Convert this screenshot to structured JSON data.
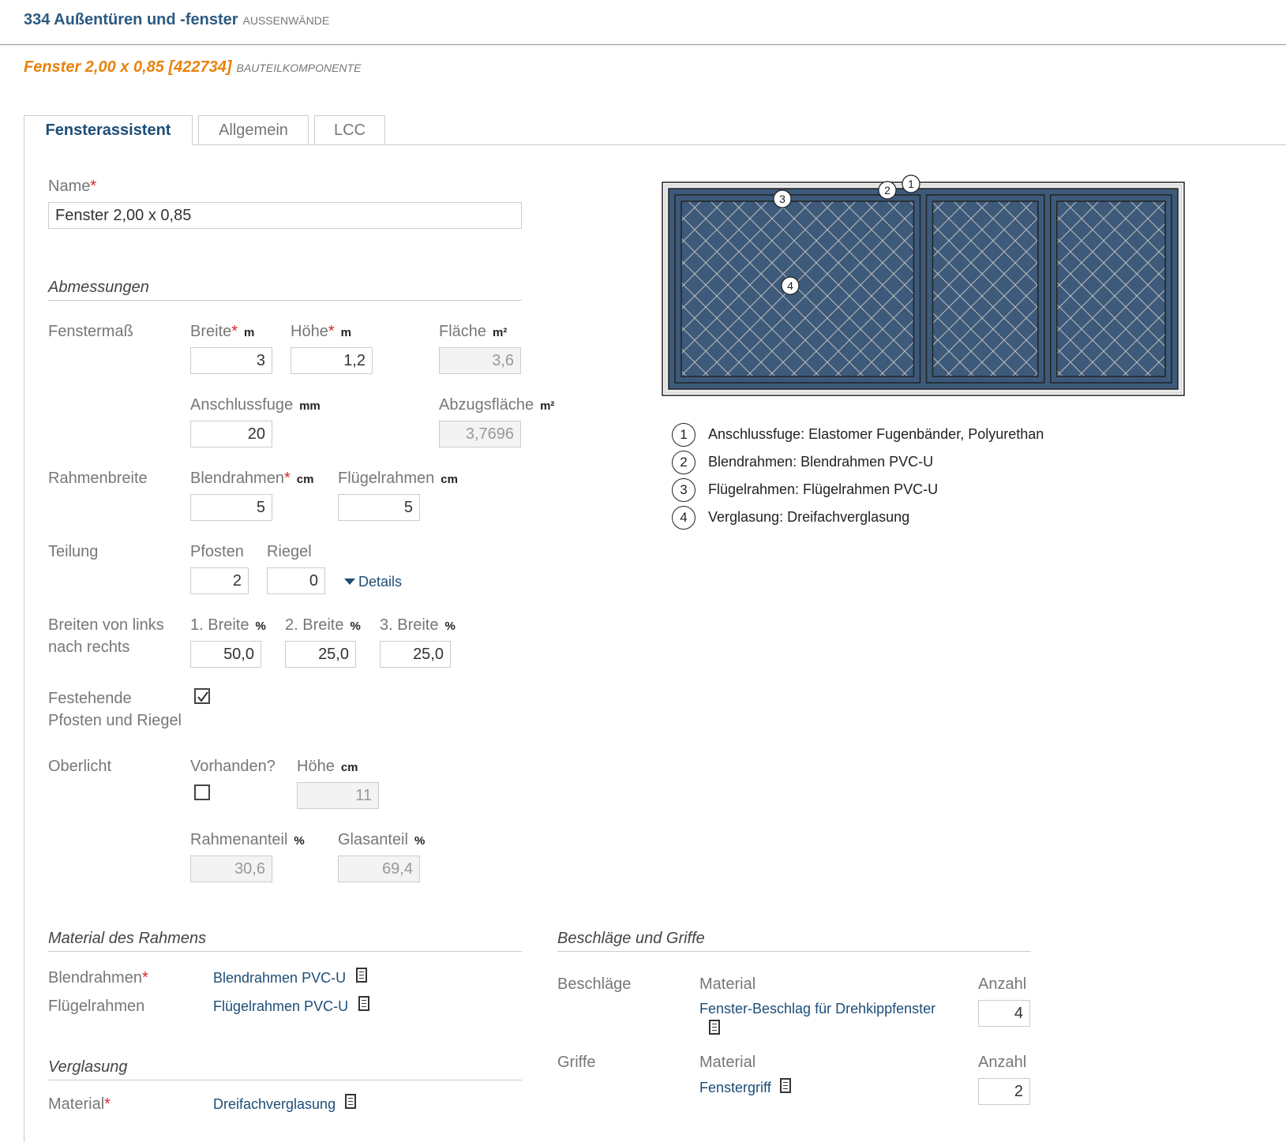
{
  "header": {
    "title": "334 Außentüren und -fenster",
    "subtitle": "AUSSENWÄNDE"
  },
  "component": {
    "title": "Fenster 2,00 x 0,85 [422734]",
    "subtitle": "BAUTEILKOMPONENTE"
  },
  "tabs": [
    {
      "label": "Fensterassistent",
      "active": true
    },
    {
      "label": "Allgemein"
    },
    {
      "label": "LCC"
    }
  ],
  "name": {
    "label": "Name",
    "value": "Fenster 2,00 x 0,85"
  },
  "abmessungen": {
    "title": "Abmessungen",
    "fenstermass": {
      "label": "Fenstermaß",
      "breite": {
        "label": "Breite",
        "unit": "m",
        "value": "3"
      },
      "hoehe": {
        "label": "Höhe",
        "unit": "m",
        "value": "1,2"
      },
      "flaeche": {
        "label": "Fläche",
        "unit": "m²",
        "value": "3,6"
      },
      "anschlussfuge": {
        "label": "Anschlussfuge",
        "unit": "mm",
        "value": "20"
      },
      "abzugsflaeche": {
        "label": "Abzugsfläche",
        "unit": "m²",
        "value": "3,7696"
      }
    },
    "rahmenbreite": {
      "label": "Rahmenbreite",
      "blendrahmen": {
        "label": "Blendrahmen",
        "unit": "cm",
        "value": "5"
      },
      "fluegelrahmen": {
        "label": "Flügelrahmen",
        "unit": "cm",
        "value": "5"
      }
    },
    "teilung": {
      "label": "Teilung",
      "pfosten": {
        "label": "Pfosten",
        "value": "2"
      },
      "riegel": {
        "label": "Riegel",
        "value": "0"
      },
      "details_label": "Details"
    },
    "breiten": {
      "label_line1": "Breiten von links",
      "label_line2": "nach rechts",
      "items": [
        {
          "label": "1. Breite",
          "unit": "%",
          "value": "50,0"
        },
        {
          "label": "2. Breite",
          "unit": "%",
          "value": "25,0"
        },
        {
          "label": "3. Breite",
          "unit": "%",
          "value": "25,0"
        }
      ]
    },
    "festehende": {
      "label_line1": "Festehende",
      "label_line2": "Pfosten und Riegel",
      "checked": true
    },
    "oberlicht": {
      "label": "Oberlicht",
      "vorhanden": {
        "label": "Vorhanden?",
        "checked": false
      },
      "hoehe": {
        "label": "Höhe",
        "unit": "cm",
        "value": "11"
      },
      "rahmenanteil": {
        "label": "Rahmenanteil",
        "unit": "%",
        "value": "30,6"
      },
      "glasanteil": {
        "label": "Glasanteil",
        "unit": "%",
        "value": "69,4"
      }
    }
  },
  "diagram": {
    "frame_color": "#3d5a7a",
    "markers": [
      "1",
      "2",
      "3",
      "4"
    ],
    "pane_fractions": [
      0.5,
      0.25,
      0.25
    ]
  },
  "legend": [
    {
      "num": "1",
      "text": "Anschlussfuge: Elastomer Fugenbänder, Polyurethan"
    },
    {
      "num": "2",
      "text": "Blendrahmen: Blendrahmen PVC-U"
    },
    {
      "num": "3",
      "text": "Flügelrahmen: Flügelrahmen PVC-U"
    },
    {
      "num": "4",
      "text": "Verglasung: Dreifachverglasung"
    }
  ],
  "material_rahmen": {
    "title": "Material des Rahmens",
    "blendrahmen": {
      "label": "Blendrahmen",
      "value": "Blendrahmen PVC-U"
    },
    "fluegelrahmen": {
      "label": "Flügelrahmen",
      "value": "Flügelrahmen PVC-U"
    }
  },
  "verglasung": {
    "title": "Verglasung",
    "material": {
      "label": "Material",
      "value": "Dreifachverglasung"
    }
  },
  "beschlaege_griffe": {
    "title": "Beschläge und Griffe",
    "beschlaege": {
      "label": "Beschläge",
      "material_label": "Material",
      "anzahl_label": "Anzahl",
      "material": "Fenster-Beschlag für Drehkippfenster",
      "anzahl": "4"
    },
    "griffe": {
      "label": "Griffe",
      "material_label": "Material",
      "anzahl_label": "Anzahl",
      "material": "Fenstergriff",
      "anzahl": "2"
    }
  }
}
